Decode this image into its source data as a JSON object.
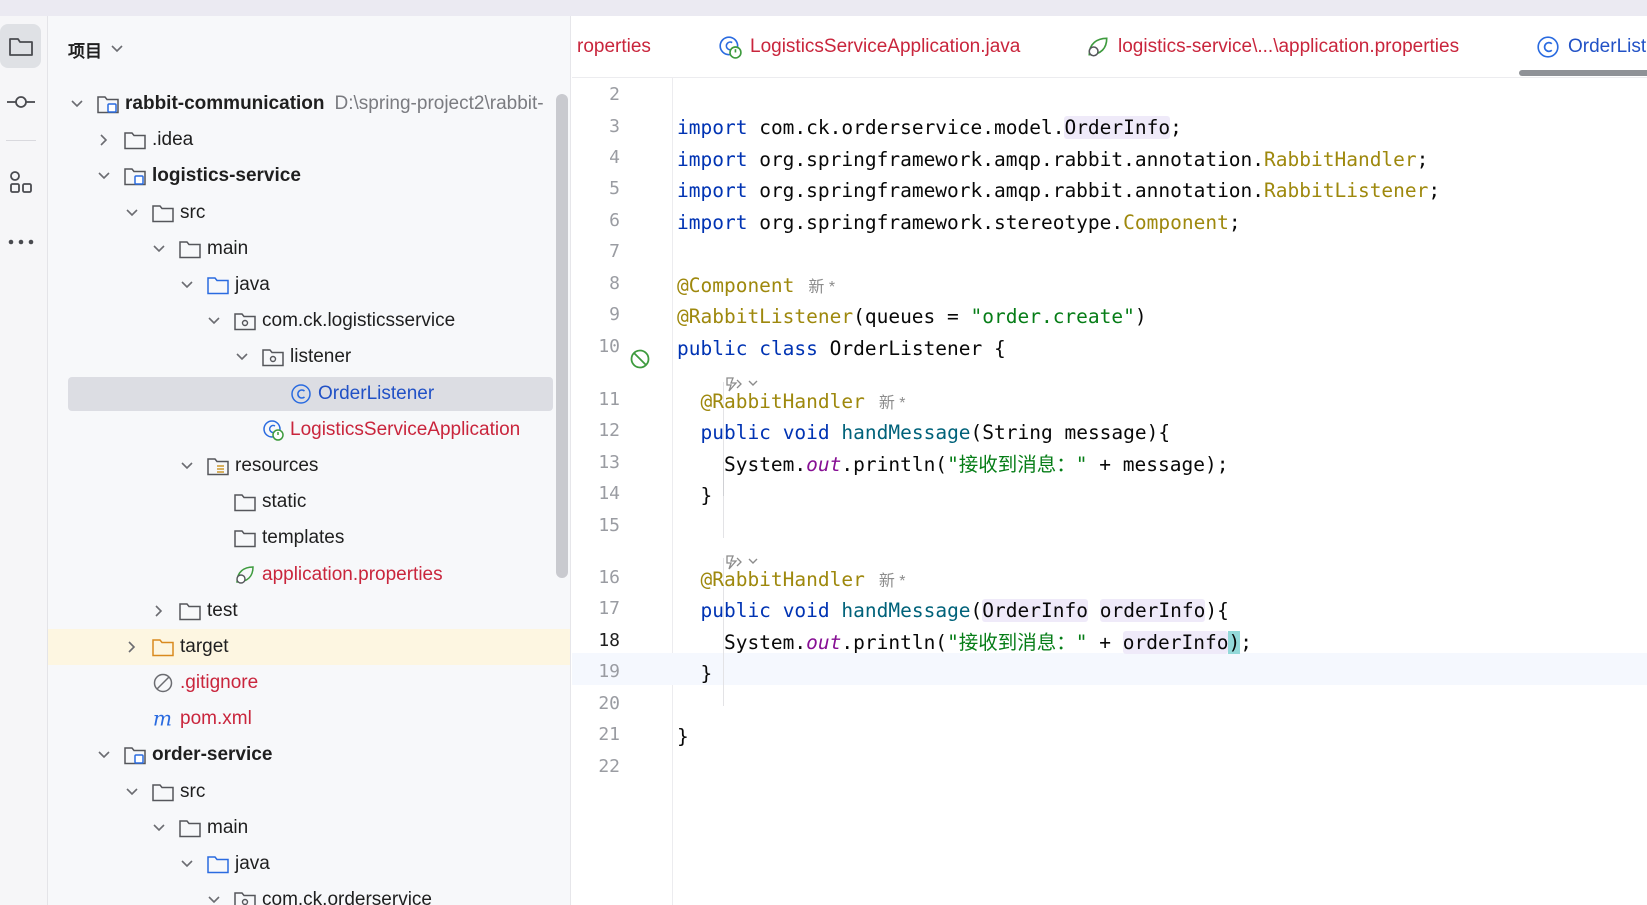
{
  "sidebar": {
    "title": "项目",
    "tree": [
      {
        "label": "rabbit-communication",
        "path": "D:\\spring-project2\\rabbit-",
        "bold": true
      },
      {
        "label": ".idea"
      },
      {
        "label": "logistics-service",
        "bold": true
      },
      {
        "label": "src"
      },
      {
        "label": "main"
      },
      {
        "label": "java"
      },
      {
        "label": "com.ck.logisticsservice"
      },
      {
        "label": "listener"
      },
      {
        "label": "OrderListener"
      },
      {
        "label": "LogisticsServiceApplication"
      },
      {
        "label": "resources"
      },
      {
        "label": "static"
      },
      {
        "label": "templates"
      },
      {
        "label": "application.properties"
      },
      {
        "label": "test"
      },
      {
        "label": "target"
      },
      {
        "label": ".gitignore"
      },
      {
        "label": "pom.xml"
      },
      {
        "label": "order-service",
        "bold": true
      },
      {
        "label": "src"
      },
      {
        "label": "main"
      },
      {
        "label": "java"
      },
      {
        "label": "com.ck.orderservice"
      }
    ]
  },
  "tabs": [
    {
      "label": "roperties"
    },
    {
      "label": "LogisticsServiceApplication.java"
    },
    {
      "label": "logistics-service\\...\\application.properties"
    },
    {
      "label": "OrderList"
    }
  ],
  "editor": {
    "line_numbers": [
      "2",
      "3",
      "4",
      "5",
      "6",
      "7",
      "8",
      "9",
      "10",
      "11",
      "12",
      "13",
      "14",
      "15",
      "16",
      "17",
      "18",
      "19",
      "20",
      "21",
      "22"
    ],
    "current_line": "18",
    "tokens": {
      "import": "import",
      "semi": ";",
      "imp1_pkg": "com.ck.orderservice.model.",
      "imp1_cls": "OrderInfo",
      "imp2_pkg": "org.springframework.amqp.rabbit.annotation.",
      "imp2_cls": "RabbitHandler",
      "imp3_pkg": "org.springframework.amqp.rabbit.annotation.",
      "imp3_cls": "RabbitListener",
      "imp4_pkg": "org.springframework.stereotype.",
      "imp4_cls": "Component",
      "ann_component": "@Component",
      "hint_new": "新 *",
      "ann_listener": "@RabbitListener",
      "listener_args_a": "(queues = ",
      "listener_queue": "\"order.create\"",
      "listener_args_b": ")",
      "kw_public": "public",
      "kw_class": "class",
      "class_decl": " OrderListener {",
      "ann_handler": "@RabbitHandler",
      "kw_void": "void",
      "method_name": "handMessage",
      "param1": "(String message){",
      "sys": "System.",
      "out": "out",
      "println": ".println(",
      "recv_str": "\"接收到消息：\"",
      "plus": " + ",
      "msg_end": "message);",
      "close_brace": "}",
      "param2_open": "(",
      "param2_type": "OrderInfo",
      "param2_name": "orderInfo",
      "param2_close": "){",
      "p_open": "(",
      "arg_orderinfo": "orderInfo",
      "p_close": ")"
    }
  },
  "colors": {
    "keyword": "#0033b3",
    "annotation": "#9e880d",
    "string": "#067d17",
    "static_field": "#871094",
    "method": "#00627a",
    "error_file": "#c9253c",
    "active_tab": "#2151c6"
  }
}
